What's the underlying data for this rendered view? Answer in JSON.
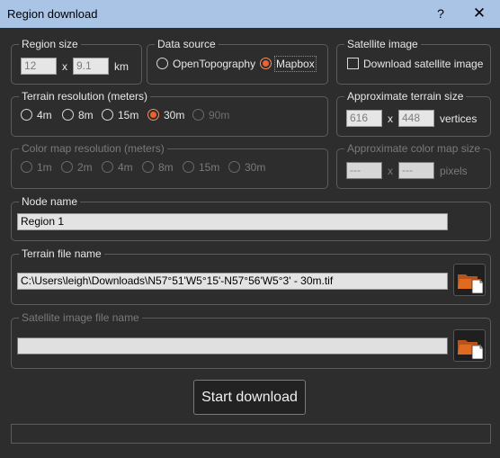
{
  "window": {
    "title": "Region download",
    "help_label": "?",
    "close_label": "✕"
  },
  "region_size": {
    "title": "Region size",
    "width_value": "12",
    "height_value": "9.1",
    "sep": "x",
    "unit": "km"
  },
  "data_source": {
    "title": "Data source",
    "options": [
      "OpenTopography",
      "Mapbox"
    ],
    "selected": "Mapbox"
  },
  "satellite_image": {
    "title": "Satellite image",
    "checkbox_label": "Download satellite image",
    "checked": false
  },
  "terrain_resolution": {
    "title": "Terrain resolution (meters)",
    "options": [
      "4m",
      "8m",
      "15m",
      "30m",
      "90m"
    ],
    "selected": "30m",
    "disabled_options": [
      "90m"
    ]
  },
  "approx_terrain_size": {
    "title": "Approximate terrain size",
    "width_value": "616",
    "height_value": "448",
    "sep": "x",
    "unit": "vertices"
  },
  "color_map_resolution": {
    "title": "Color map resolution (meters)",
    "options": [
      "1m",
      "2m",
      "4m",
      "8m",
      "15m",
      "30m"
    ],
    "enabled": false
  },
  "approx_color_map_size": {
    "title": "Approximate color map size",
    "width_value": "---",
    "height_value": "---",
    "sep": "x",
    "unit": "pixels",
    "enabled": false
  },
  "node_name": {
    "title": "Node name",
    "value": "Region 1"
  },
  "terrain_file": {
    "title": "Terrain file name",
    "value": "C:\\Users\\leigh\\Downloads\\N57°51'W5°15'-N57°56'W5°3' - 30m.tif"
  },
  "satellite_file": {
    "title": "Satellite image file name",
    "value": "",
    "enabled": false
  },
  "actions": {
    "start_label": "Start download"
  },
  "progress": {
    "value": 0
  },
  "colors": {
    "titlebar": "#a9c4e4",
    "background": "#2d2d2d",
    "accent": "#f0612e",
    "folder": "#e06a20"
  },
  "icons": {
    "browse": "folder-open-icon"
  }
}
